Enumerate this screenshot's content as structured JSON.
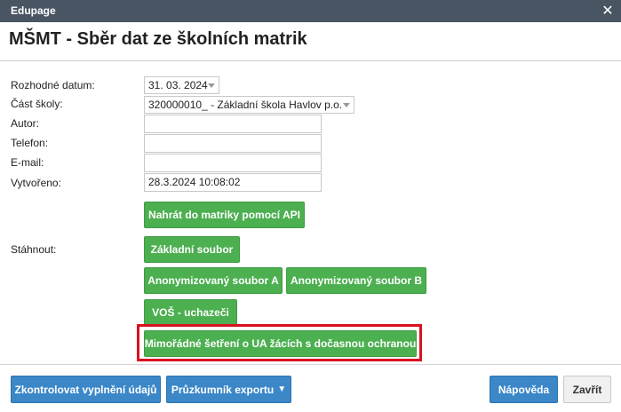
{
  "window": {
    "app_title": "Edupage",
    "close_icon": "close-icon"
  },
  "dialog": {
    "title": "MŠMT - Sběr dat ze školních matrik"
  },
  "form": {
    "decision_date_label": "Rozhodné datum:",
    "decision_date_value": "31. 03. 2024",
    "school_part_label": "Část školy:",
    "school_part_value": "320000010_ - Základní škola Havlov p.o.",
    "author_label": "Autor:",
    "author_value": "",
    "phone_label": "Telefon:",
    "phone_value": "",
    "email_label": "E-mail:",
    "email_value": "",
    "created_label": "Vytvořeno:",
    "created_value": "28.3.2024 10:08:02"
  },
  "actions": {
    "upload_api": "Nahrát do matriky pomocí API",
    "download_label": "Stáhnout:",
    "basic_file": "Základní soubor",
    "anon_a": "Anonymizovaný soubor A",
    "anon_b": "Anonymizovaný soubor B",
    "vos": "VOŠ - uchazeči",
    "extraordinary": "Mimořádné šetření o UA žácích s dočasnou ochranou"
  },
  "footer": {
    "check_fill": "Zkontrolovat vyplnění údajů",
    "export_explorer": "Průzkumník exportu",
    "dropdown_glyph": "▼",
    "help": "Nápověda",
    "close": "Zavřít"
  },
  "colors": {
    "titlebar": "#4a5563",
    "green_button": "#4caf50",
    "blue_button": "#3b87c8",
    "highlight_border": "#d9121f"
  }
}
